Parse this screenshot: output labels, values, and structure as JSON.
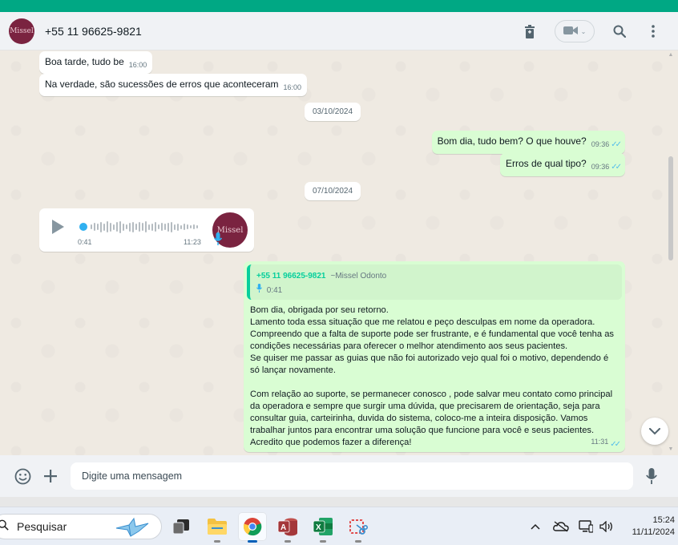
{
  "header": {
    "contact": "+55 11 96625-9821",
    "avatar_text": "Missel"
  },
  "messages": [
    {
      "dir": "in",
      "text": "Boa tarde, tudo be",
      "time": "16:00"
    },
    {
      "dir": "in",
      "text": "Na verdade, são sucessões de erros que aconteceram",
      "time": "16:00"
    },
    {
      "type": "date",
      "text": "03/10/2024"
    },
    {
      "dir": "out",
      "text": "Bom dia, tudo bem? O que houve?",
      "time": "09:36"
    },
    {
      "dir": "out",
      "text": "Erros de qual tipo?",
      "time": "09:36"
    },
    {
      "type": "date",
      "text": "07/10/2024"
    }
  ],
  "voice": {
    "duration": "0:41",
    "time": "11:23",
    "avatar_text": "Missel"
  },
  "reply": {
    "quoted_number": "+55 11 96625-9821",
    "quoted_pushname": "~Missel Odonto",
    "quoted_audio": "0:41",
    "body": "Bom dia, obrigada por seu retorno.\nLamento toda essa situação que me relatou e peço desculpas em nome da operadora.\nCompreendo que a falta de suporte pode ser frustrante, e é fundamental que você tenha as condições necessárias para oferecer o melhor atendimento aos seus pacientes.\nSe quiser me passar as guias que não foi autorizado vejo qual foi o motivo, dependendo é só lançar novamente.\n\nCom relação ao suporte, se permanecer conosco , pode salvar meu contato como principal da operadora e sempre que surgir uma dúvida, que precisarem de orientação, seja para consultar guia, carteirinha, duvida do sistema, coloco-me a inteira disposição. Vamos trabalhar juntos para encontrar uma solução que funcione para você e seus pacientes. Acredito que podemos fazer a diferença!",
    "time": "11:31"
  },
  "composer": {
    "placeholder": "Digite uma mensagem"
  },
  "taskbar": {
    "search_label": "Pesquisar",
    "time": "15:24",
    "date": "11/11/2024"
  }
}
